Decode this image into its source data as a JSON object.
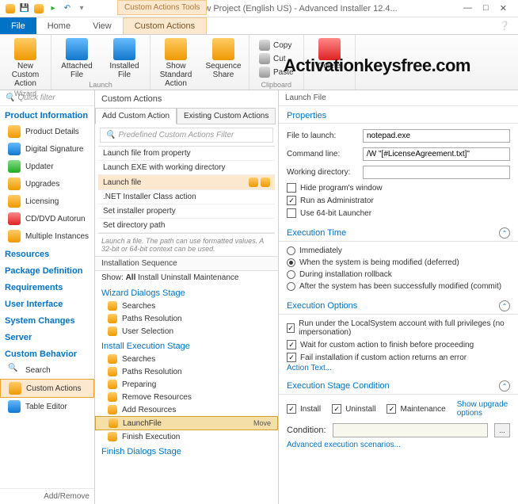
{
  "title": "Your Application - New Project (English US) - Advanced Installer 12.4...",
  "context_tab": "Custom Actions Tools",
  "menu": {
    "file": "File",
    "home": "Home",
    "view": "View",
    "custom_actions": "Custom Actions"
  },
  "ribbon": {
    "new_custom_action": "New Custom\nAction",
    "attached_file": "Attached\nFile",
    "installed_file": "Installed\nFile",
    "show_standard_action": "Show Standard\nAction",
    "sequence_share": "Sequence\nShare",
    "copy": "Copy",
    "cut": "Cut",
    "paste": "Paste",
    "delete": "Delete",
    "grp_wizard": "Wizard",
    "grp_launch": "Launch",
    "grp_clipboard": "Clipboard"
  },
  "watermark": "Activationkeysfree.com",
  "quickfilter_ph": "Quick filter",
  "nav": {
    "product_information": "Product Information",
    "product_details": "Product Details",
    "digital_signature": "Digital Signature",
    "updater": "Updater",
    "upgrades": "Upgrades",
    "licensing": "Licensing",
    "cd_dvd_autorun": "CD/DVD Autorun",
    "multiple_instances": "Multiple Instances",
    "resources": "Resources",
    "package_definition": "Package Definition",
    "requirements": "Requirements",
    "user_interface": "User Interface",
    "system_changes": "System Changes",
    "server": "Server",
    "custom_behavior": "Custom Behavior",
    "search": "Search",
    "custom_actions": "Custom Actions",
    "table_editor": "Table Editor",
    "footer": "Add/Remove"
  },
  "mid": {
    "title": "Custom Actions",
    "tab_add": "Add Custom Action",
    "tab_existing": "Existing Custom Actions",
    "filter_ph": "Predefined Custom Actions Filter",
    "list": [
      "Launch file from property",
      "Launch EXE with working directory",
      "Launch file",
      ".NET Installer Class action",
      "Set installer property",
      "Set directory path"
    ],
    "hint": "Launch a file. The path can use formatted values. A 32-bit or 64-bit context can be used.",
    "seq_title": "Installation Sequence",
    "show": "Show:",
    "show_all": "All",
    "show_install": "Install",
    "show_uninstall": "Uninstall",
    "show_maint": "Maintenance",
    "stage_wizard": "Wizard Dialogs Stage",
    "wiz_items": [
      "Searches",
      "Paths Resolution",
      "User Selection"
    ],
    "stage_install": "Install Execution Stage",
    "inst_items": [
      "Searches",
      "Paths Resolution",
      "Preparing",
      "Remove Resources",
      "Add Resources",
      "LaunchFile",
      "Finish Execution"
    ],
    "move": "Move",
    "stage_finish": "Finish Dialogs Stage"
  },
  "right": {
    "title": "Launch File",
    "sec_props": "Properties",
    "file_to_launch_l": "File to launch:",
    "file_to_launch_v": "notepad.exe",
    "cmd_line_l": "Command line:",
    "cmd_line_v": "/W \"[#LicenseAgreement.txt]\"",
    "working_dir_l": "Working directory:",
    "working_dir_v": "",
    "hide_window": "Hide program's window",
    "run_admin": "Run as Administrator",
    "use_64": "Use 64-bit Launcher",
    "sec_time": "Execution Time",
    "et_immediately": "Immediately",
    "et_deferred": "When the system is being modified (deferred)",
    "et_rollback": "During installation rollback",
    "et_commit": "After the system has been successfully modified (commit)",
    "sec_opts": "Execution Options",
    "eo_local": "Run under the LocalSystem account with full privileges (no impersonation)",
    "eo_wait": "Wait for custom action to finish before proceeding",
    "eo_fail": "Fail installation if custom action returns an error",
    "action_text": "Action Text...",
    "sec_stage": "Execution Stage Condition",
    "esc_install": "Install",
    "esc_uninstall": "Uninstall",
    "esc_maint": "Maintenance",
    "show_upgrade": "Show upgrade options",
    "condition_l": "Condition:",
    "adv_scen": "Advanced execution scenarios..."
  }
}
